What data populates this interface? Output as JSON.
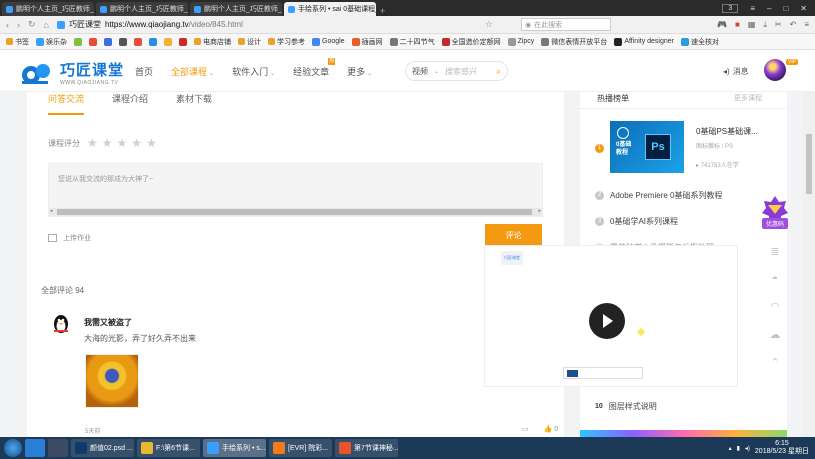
{
  "browser": {
    "tabs": [
      {
        "label": "鹏明个人主页_巧匠教师_巧匠课",
        "active": false
      },
      {
        "label": "鹏明个人主页_巧匠教师_巧匠课堂",
        "active": false
      },
      {
        "label": "鹏明个人主页_巧匠教师_巧匠课",
        "active": false
      },
      {
        "label": "手绘系列 • sai 0基础课程_SAI课",
        "active": true
      }
    ],
    "window_badge": "3",
    "address": {
      "site_name": "巧匠课堂",
      "host": "https://www.qiaojiang.tv",
      "path": "/video/845.html"
    },
    "search_placeholder": "在此搜索",
    "bookmarks": [
      "书签",
      "娱乐杂",
      "",
      "",
      "",
      "",
      "",
      "",
      "",
      "",
      "电商店铺",
      "设计",
      "学习参考",
      "Google",
      "插画网",
      "二十四节气",
      "全国造价定额网",
      "Zipcy",
      "微信表情开放平台",
      "Affinity designer",
      "速全核对"
    ]
  },
  "header": {
    "logo_cn": "巧匠课堂",
    "logo_en": "WWW.QIAOJIANG.TV",
    "nav": [
      {
        "label": "首页",
        "active": false,
        "caret": false
      },
      {
        "label": "全部课程",
        "active": true,
        "caret": true
      },
      {
        "label": "软件入门",
        "active": false,
        "caret": true
      },
      {
        "label": "经验文章",
        "active": false,
        "caret": false,
        "badge": "热"
      },
      {
        "label": "更多",
        "active": false,
        "caret": true
      }
    ],
    "search": {
      "category": "视频",
      "placeholder": "搜索感兴"
    },
    "messages_label": "消息",
    "vip_label": "VIP"
  },
  "main": {
    "tabs": [
      {
        "label": "问答交流",
        "active": true
      },
      {
        "label": "课程介绍",
        "active": false
      },
      {
        "label": "素材下载",
        "active": false
      }
    ],
    "rating_label": "课程评分",
    "stars": 5,
    "comment_placeholder": "您说从我交流的那成为大神了~",
    "upload_label": "上传作业",
    "submit_label": "评论",
    "total_label": "全部评论 94",
    "comment": {
      "user": "我需又被盗了",
      "text": "大海的光影，弄了好久弄不出来",
      "time": "5天前",
      "likes": "0"
    }
  },
  "sidebar": {
    "heading": "热播榜单",
    "more": "更多课程",
    "featured": {
      "rank": "1",
      "title": "0基础PS基础课...",
      "subtitle": "图标徽标 / PS",
      "count": "741783人在学",
      "thumb_label": "0基础\n教程",
      "thumb_ps": "Ps"
    },
    "items": [
      {
        "rank": "2",
        "title": "Adobe Premiere 0基础系列教程"
      },
      {
        "rank": "3",
        "title": "0基础学AI系列课程"
      },
      {
        "rank": "4",
        "title": "零基础学人像摄影与后期处理"
      },
      {
        "rank": "10",
        "title": "图层样式说明"
      }
    ]
  },
  "video": {
    "logo_text": "巧匠课堂"
  },
  "float": {
    "vip_label": "优惠码"
  },
  "taskbar": {
    "apps": [
      {
        "label": "颜值02.psd ...",
        "color": "#0f3c6b"
      },
      {
        "label": "F:\\第6节课...",
        "color": "#e8b830"
      },
      {
        "label": "手绘系列 • s...",
        "color": "#3aa0ff"
      },
      {
        "label": "[EVR] 院彩...",
        "color": "#f07c1e"
      },
      {
        "label": "第7节课神秘...",
        "color": "#e8532c"
      }
    ],
    "time": "6:15",
    "date": "2018/5/23 星期日"
  },
  "colors": {
    "accent": "#f39a12",
    "brand": "#1677d2"
  }
}
